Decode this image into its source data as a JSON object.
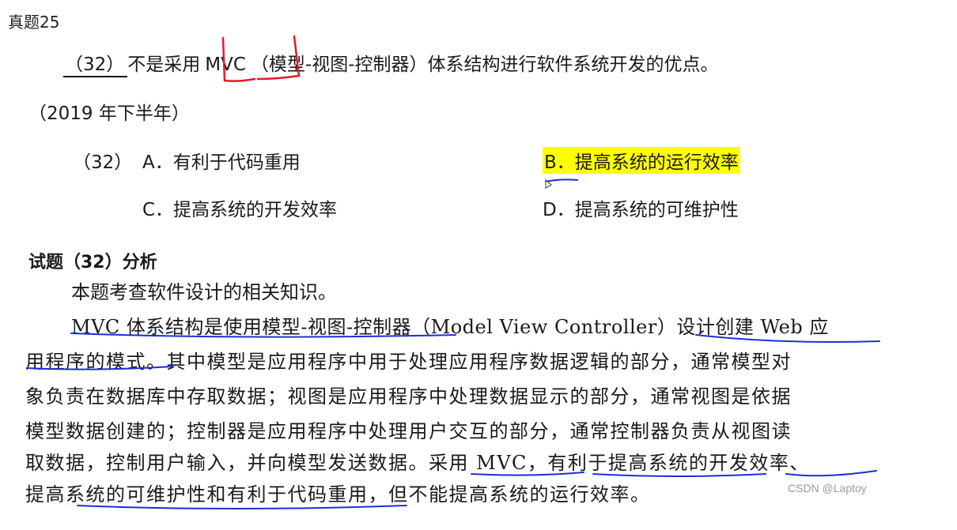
{
  "page_title": "真题25",
  "question": {
    "blank": "（32）",
    "before_mvc": "不是采用",
    "mvc": "MVC",
    "after_mvc": "（模型-视图-控制器）体系结构进行软件系统开发的优点。",
    "year": "（2019 年下半年）"
  },
  "options": {
    "label": "（32）",
    "a": "A．有利于代码重用",
    "b": "B．提高系统的运行效率",
    "c": "C．提高系统的开发效率",
    "d": "D．提高系统的可维护性"
  },
  "analysis": {
    "title": "试题（32）分析",
    "intro": "本题考查软件设计的相关知识。",
    "lines": [
      "MVC 体系结构是使用模型-视图-控制器（Model View Controller）设计创建 Web 应",
      "用程序的模式。其中模型是应用程序中用于处理应用程序数据逻辑的部分，通常模型对",
      "象负责在数据库中存取数据；视图是应用程序中处理数据显示的部分，通常视图是依据",
      "模型数据创建的；控制器是应用程序中处理用户交互的部分，通常控制器负责从视图读",
      "取数据，控制用户输入，并向模型发送数据。采用 MVC，有利于提高系统的开发效率、",
      "提高系统的可维护性和有利于代码重用，但不能提高系统的运行效率。"
    ]
  },
  "watermark": "CSDN @Laptoy",
  "colors": {
    "highlight": "#ffff00",
    "red_ink": "#e8182a",
    "blue_ink": "#1b2fd6"
  }
}
